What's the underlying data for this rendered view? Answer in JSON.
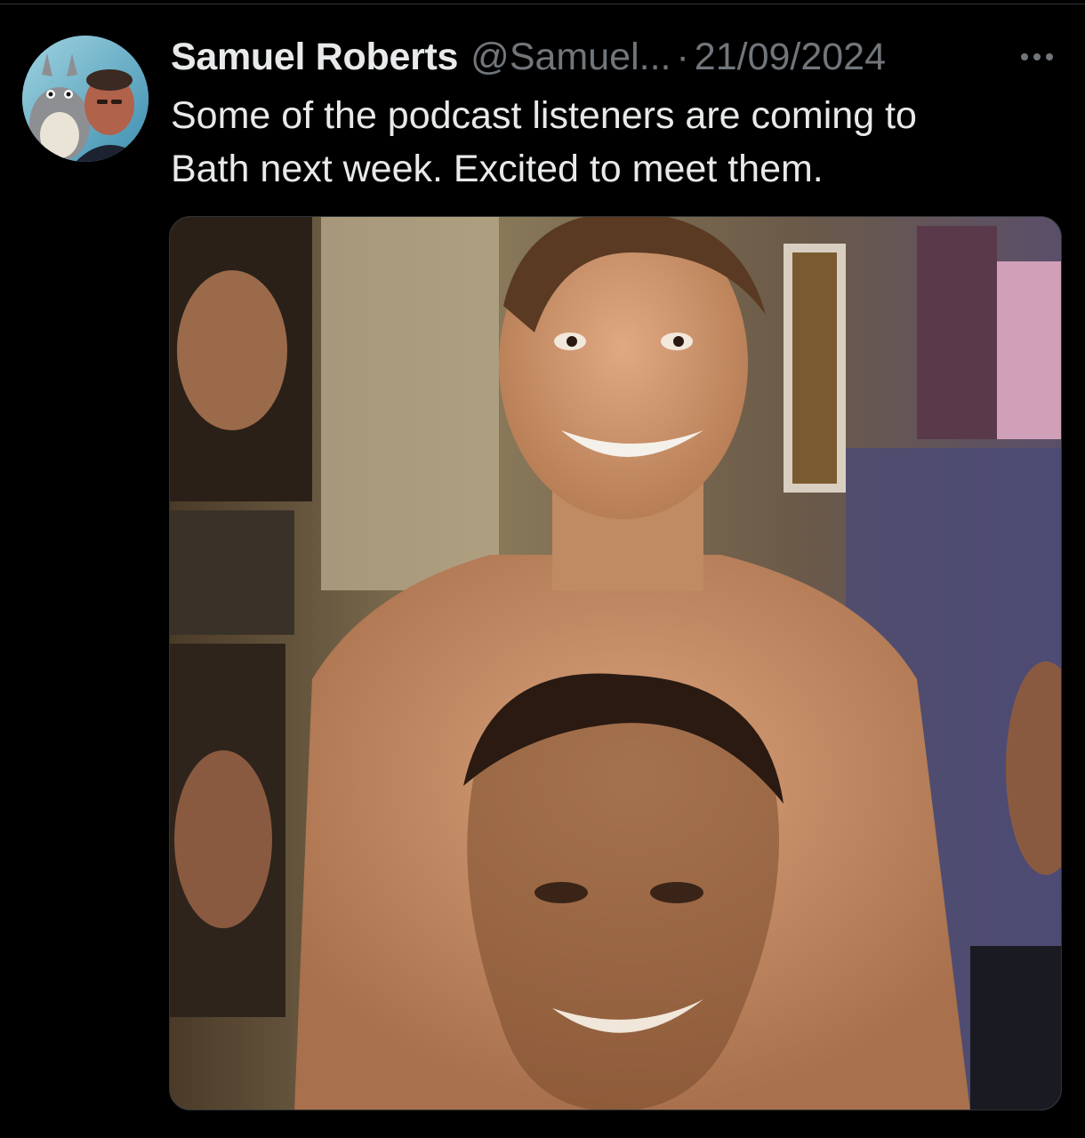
{
  "tweet": {
    "author": {
      "display_name": "Samuel Roberts",
      "handle": "@Samuel...",
      "avatar_icon": "user-avatar"
    },
    "separator": "·",
    "date": "21/09/2024",
    "text_lines": [
      "Some of the podcast listeners are coming to",
      "Bath next week. Excited to meet them."
    ],
    "more_icon": "more-horizontal-icon",
    "media": {
      "type": "photo"
    }
  },
  "colors": {
    "background": "#000000",
    "primary_text": "#e7e9ea",
    "secondary_text": "#71767b",
    "divider": "#2f3336"
  }
}
